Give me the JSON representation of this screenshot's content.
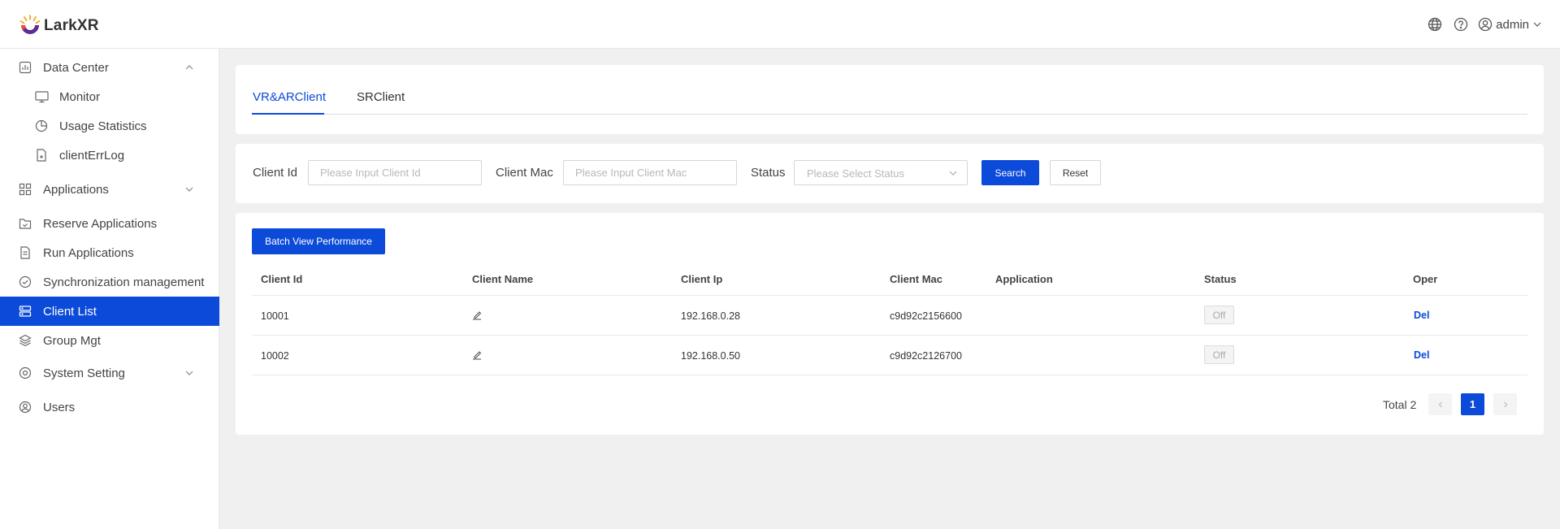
{
  "app": {
    "name": "LarkXR",
    "brand_color": "#0c4ad9",
    "logo_colors": [
      "#f5a623",
      "#e94e3c",
      "#5b2d8f"
    ]
  },
  "header": {
    "language_icon": "globe-icon",
    "help_icon": "question-circle-icon",
    "user": "admin"
  },
  "sidebar": {
    "items": [
      {
        "label": "Data Center",
        "icon": "bar-chart-icon"
      },
      {
        "label": "Monitor",
        "icon": "monitor-icon"
      },
      {
        "label": "Usage Statistics",
        "icon": "pie-chart-icon"
      },
      {
        "label": "clientErrLog",
        "icon": "file-icon"
      },
      {
        "label": "Applications",
        "icon": "grid-icon"
      },
      {
        "label": "Reserve Applications",
        "icon": "folder-check-icon"
      },
      {
        "label": "Run Applications",
        "icon": "document-icon"
      },
      {
        "label": "Synchronization management",
        "icon": "check-circle-icon"
      },
      {
        "label": "Client List",
        "icon": "server-icon",
        "active": true
      },
      {
        "label": "Group Mgt",
        "icon": "layers-icon"
      },
      {
        "label": "System Setting",
        "icon": "settings-icon"
      },
      {
        "label": "Users",
        "icon": "user-circle-icon"
      }
    ]
  },
  "tabs": [
    {
      "label": "VR&ARClient",
      "active": true
    },
    {
      "label": "SRClient",
      "active": false
    }
  ],
  "filters": {
    "client_id_label": "Client Id",
    "client_id_placeholder": "Please Input Client Id",
    "client_mac_label": "Client Mac",
    "client_mac_placeholder": "Please Input Client Mac",
    "status_label": "Status",
    "status_placeholder": "Please Select Status",
    "search_label": "Search",
    "reset_label": "Reset"
  },
  "table": {
    "batch_button": "Batch View Performance",
    "columns": [
      "Client Id",
      "Client Name",
      "Client Ip",
      "Client Mac",
      "Application",
      "Status",
      "Oper"
    ],
    "rows": [
      {
        "client_id": "10001",
        "client_name": "",
        "client_ip": "192.168.0.28",
        "client_mac": "c9d92c2156600",
        "application": "",
        "status": "Off",
        "oper": "Del"
      },
      {
        "client_id": "10002",
        "client_name": "",
        "client_ip": "192.168.0.50",
        "client_mac": "c9d92c2126700",
        "application": "",
        "status": "Off",
        "oper": "Del"
      }
    ]
  },
  "pagination": {
    "total_label": "Total 2",
    "current_page": "1"
  }
}
